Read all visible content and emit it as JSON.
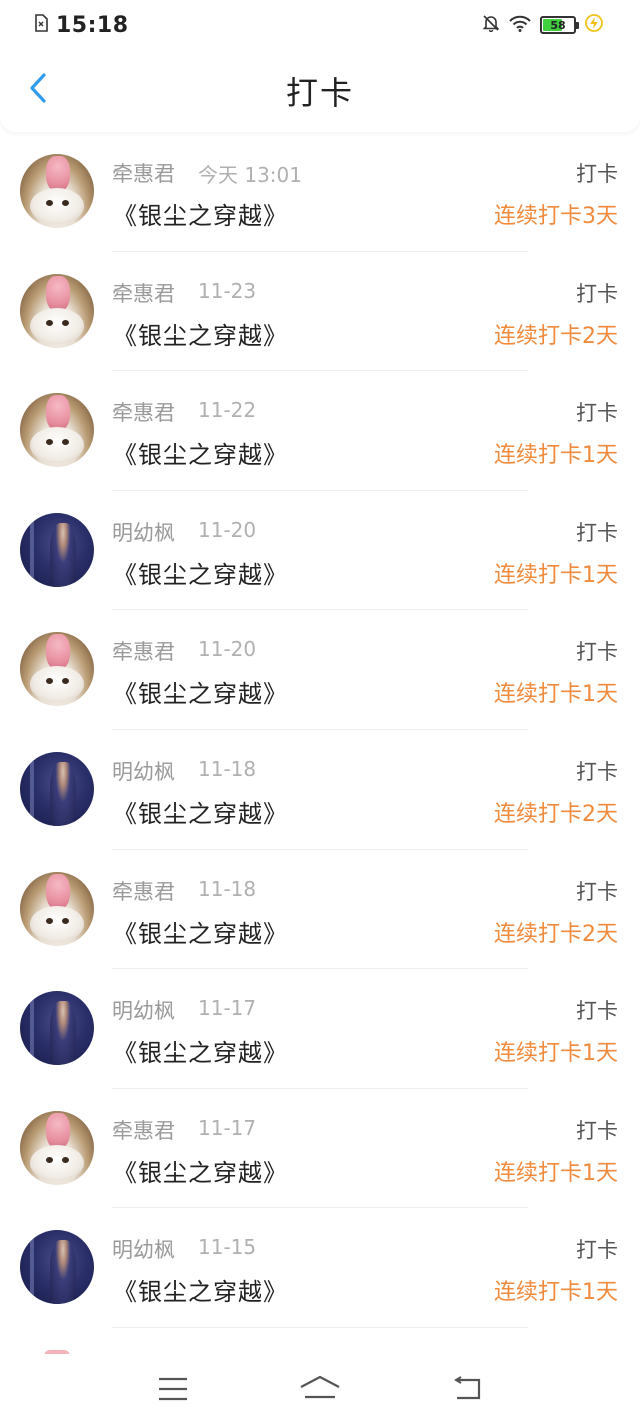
{
  "status_bar": {
    "time": "15:18",
    "battery": "58",
    "battery_fraction": 0.58
  },
  "header": {
    "title": "打卡"
  },
  "colors": {
    "accent_blue": "#2f9bea",
    "streak_orange": "#f08a3c",
    "battery_green": "#3fcf3f"
  },
  "records": [
    {
      "user": "牵惠君",
      "date": "今天 13:01",
      "type": "打卡",
      "book": "《银尘之穿越》",
      "streak": "连续打卡3天",
      "avatar": "cat"
    },
    {
      "user": "牵惠君",
      "date": "11-23",
      "type": "打卡",
      "book": "《银尘之穿越》",
      "streak": "连续打卡2天",
      "avatar": "cat"
    },
    {
      "user": "牵惠君",
      "date": "11-22",
      "type": "打卡",
      "book": "《银尘之穿越》",
      "streak": "连续打卡1天",
      "avatar": "cat"
    },
    {
      "user": "明幼枫",
      "date": "11-20",
      "type": "打卡",
      "book": "《银尘之穿越》",
      "streak": "连续打卡1天",
      "avatar": "man"
    },
    {
      "user": "牵惠君",
      "date": "11-20",
      "type": "打卡",
      "book": "《银尘之穿越》",
      "streak": "连续打卡1天",
      "avatar": "cat"
    },
    {
      "user": "明幼枫",
      "date": "11-18",
      "type": "打卡",
      "book": "《银尘之穿越》",
      "streak": "连续打卡2天",
      "avatar": "man"
    },
    {
      "user": "牵惠君",
      "date": "11-18",
      "type": "打卡",
      "book": "《银尘之穿越》",
      "streak": "连续打卡2天",
      "avatar": "cat"
    },
    {
      "user": "明幼枫",
      "date": "11-17",
      "type": "打卡",
      "book": "《银尘之穿越》",
      "streak": "连续打卡1天",
      "avatar": "man"
    },
    {
      "user": "牵惠君",
      "date": "11-17",
      "type": "打卡",
      "book": "《银尘之穿越》",
      "streak": "连续打卡1天",
      "avatar": "cat"
    },
    {
      "user": "明幼枫",
      "date": "11-15",
      "type": "打卡",
      "book": "《银尘之穿越》",
      "streak": "连续打卡1天",
      "avatar": "man"
    }
  ],
  "icons": {
    "back": "chevron-left-icon",
    "menu": "menu-icon",
    "home": "home-icon",
    "return": "return-icon"
  }
}
